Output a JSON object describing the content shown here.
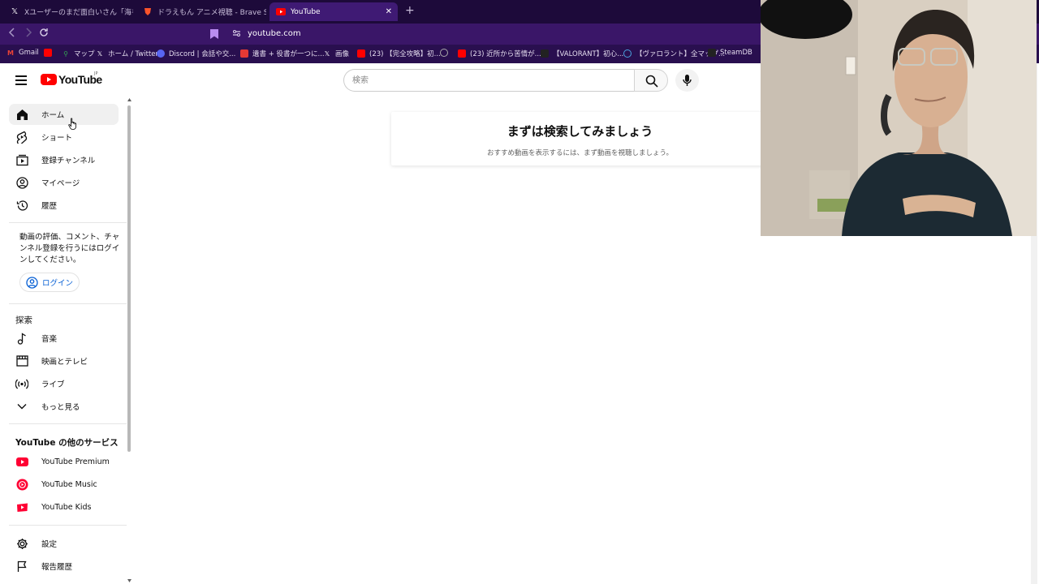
{
  "browser": {
    "tabs": [
      {
        "title": "Xユーザーのまだ面白いさん「海を蔵がド",
        "favicon": "x-logo-icon"
      },
      {
        "title": "ドラえもん アニメ視聴 - Brave Search",
        "favicon": "brave-icon"
      },
      {
        "title": "YouTube",
        "favicon": "youtube-icon",
        "active": true
      }
    ],
    "url": "youtube.com",
    "bookmarks": [
      {
        "label": "Gmail",
        "color": "#ea4335"
      },
      {
        "label": "",
        "color": "#ff0000"
      },
      {
        "label": "マップ",
        "color": "#34a853"
      },
      {
        "label": "ホーム / Twitter",
        "color": "#ffffff"
      },
      {
        "label": "Discord | 会話や交...",
        "color": "#5865f2"
      },
      {
        "label": "遺書 + 役書が一つに...",
        "color": "#e53935"
      },
      {
        "label": "画像",
        "color": "#ffffff"
      },
      {
        "label": "(23) 【完全攻略】初...",
        "color": "#ff0000"
      },
      {
        "label": "",
        "color": "#aaaaaa"
      },
      {
        "label": "(23) 近所から苦情が...",
        "color": "#ff0000"
      },
      {
        "label": "【VALORANT】初心...",
        "color": "#222222"
      },
      {
        "label": "【ヴァロラント】全マップ...",
        "color": "#4aa3df"
      },
      {
        "label": "SteamDB",
        "color": "#222222"
      }
    ]
  },
  "youtube": {
    "logo_text": "YouTube",
    "region": "JP",
    "search_placeholder": "検索",
    "nav": [
      {
        "label": "ホーム",
        "icon": "home-icon",
        "active": true
      },
      {
        "label": "ショート",
        "icon": "shorts-icon"
      },
      {
        "label": "登録チャンネル",
        "icon": "subscriptions-icon"
      },
      {
        "label": "マイページ",
        "icon": "account-icon"
      },
      {
        "label": "履歴",
        "icon": "history-icon"
      }
    ],
    "login_note": "動画の評価、コメント、チャンネル登録を行うにはログインしてください。",
    "login_label": "ログイン",
    "explore_title": "探索",
    "explore": [
      {
        "label": "音楽",
        "icon": "music-icon"
      },
      {
        "label": "映画とテレビ",
        "icon": "movies-icon"
      },
      {
        "label": "ライブ",
        "icon": "live-icon"
      },
      {
        "label": "もっと見る",
        "icon": "chevron-down-icon"
      }
    ],
    "more_title": "YouTube の他のサービス",
    "more": [
      {
        "label": "YouTube Premium",
        "icon": "youtube-premium-icon"
      },
      {
        "label": "YouTube Music",
        "icon": "youtube-music-icon"
      },
      {
        "label": "YouTube Kids",
        "icon": "youtube-kids-icon"
      }
    ],
    "footer": [
      {
        "label": "設定",
        "icon": "settings-icon"
      },
      {
        "label": "報告履歴",
        "icon": "flag-icon"
      }
    ],
    "prompt_title": "まずは検索してみましょう",
    "prompt_subtitle": "おすすめ動画を表示するには、まず動画を視聴しましょう。"
  },
  "colors": {
    "brand_red": "#ff0000",
    "link_blue": "#065fd4",
    "browser_tabbar": "#1d0a3a",
    "browser_toolbar": "#3a1668"
  }
}
